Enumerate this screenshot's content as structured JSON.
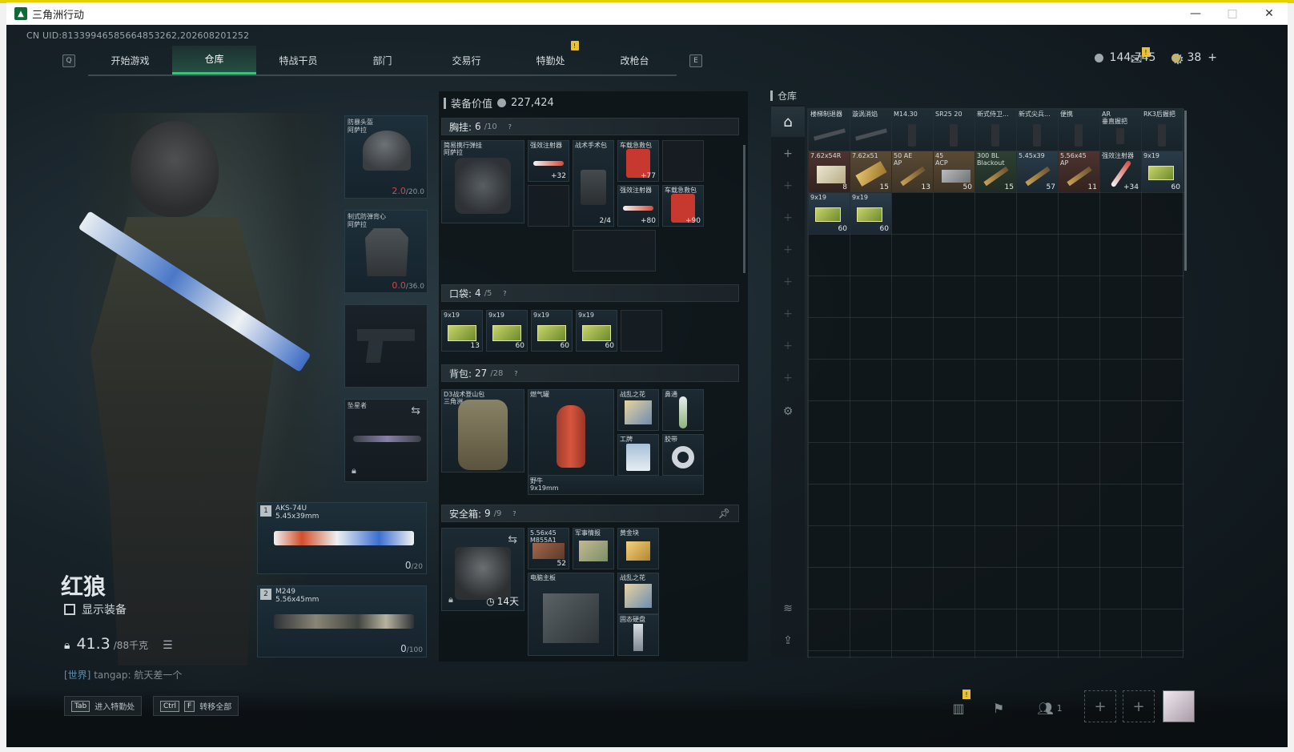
{
  "window": {
    "title": "三角洲行动",
    "minimize": "—",
    "maximize": "□",
    "close": "✕"
  },
  "header": {
    "uid": "CN UID:8133994658566485326​2,202608201252",
    "key_left": "Q",
    "key_right": "E",
    "tabs": [
      {
        "label": "开始游戏",
        "active": false
      },
      {
        "label": "仓库",
        "active": true
      },
      {
        "label": "特战干员",
        "active": false
      },
      {
        "label": "部门",
        "active": false
      },
      {
        "label": "交易行",
        "active": false
      },
      {
        "label": "特勤处",
        "active": false,
        "badge": "!"
      },
      {
        "label": "改枪台",
        "active": false
      }
    ],
    "silver": "144,745",
    "gold": "38",
    "gold_plus": "+",
    "mail_badge": "!"
  },
  "character": {
    "name": "红狼",
    "show_equip_label": "显示装备",
    "weight_value": "41.3",
    "weight_max": "/88千克",
    "chat_channel": "[世界]",
    "chat_text": "tangap: 航天差一个"
  },
  "equipment": {
    "helmet": {
      "label": "防暴头盔\n阿萨拉",
      "durability": "2.0",
      "max": "/20.0"
    },
    "armor": {
      "label": "制式防弹背心\n阿萨拉",
      "durability": "0.0",
      "max": "/36.0"
    },
    "melee": {
      "label": "坠星者"
    },
    "weapon1": {
      "num": "1",
      "name": "AKS-74U\n5.45x39mm",
      "ammo": "0",
      "ammo_max": "/20"
    },
    "weapon2": {
      "num": "2",
      "name": "M249\n5.56x45mm",
      "ammo": "0",
      "ammo_max": "/100"
    }
  },
  "loadout": {
    "value_label": "装备价值",
    "value": "227,424",
    "chest": {
      "title": "胸挂:",
      "count": "6",
      "cap": "/10",
      "q": "?",
      "rig_label": "简易携行弹挂\n阿萨拉",
      "items": [
        {
          "label": "强效注射器",
          "count": "+32"
        },
        {
          "label": "战术手术包",
          "count": "2/4"
        },
        {
          "label": "车载急救包",
          "count": "+77"
        },
        {
          "label": "强效注射器",
          "count": "+80"
        },
        {
          "label": "车载急救包",
          "count": "+90"
        }
      ]
    },
    "pocket": {
      "title": "口袋:",
      "count": "4",
      "cap": "/5",
      "q": "?",
      "items": [
        {
          "label": "9x19",
          "count": "13"
        },
        {
          "label": "9x19",
          "count": "60"
        },
        {
          "label": "9x19",
          "count": "60"
        },
        {
          "label": "9x19",
          "count": "60"
        }
      ]
    },
    "backpack": {
      "title": "背包:",
      "count": "27",
      "cap": "/28",
      "q": "?",
      "bag_label": "D3战术登山包\n三角洲",
      "items": [
        {
          "label": "燃气罐"
        },
        {
          "label": "战乱之花"
        },
        {
          "label": "鼻通"
        },
        {
          "label": "工牌"
        },
        {
          "label": "胶带"
        },
        {
          "label": "野牛\n9x19mm"
        }
      ]
    },
    "safe": {
      "title": "安全箱:",
      "count": "9",
      "cap": "/9",
      "q": "?",
      "timer": "14天",
      "items": [
        {
          "label": "5.56x45\nM855A1",
          "count": "52"
        },
        {
          "label": "军事情报"
        },
        {
          "label": "黄金块"
        },
        {
          "label": "电脑主板"
        },
        {
          "label": "战乱之花"
        },
        {
          "label": "固态硬盘"
        }
      ]
    }
  },
  "storage": {
    "title": "仓库",
    "row1": [
      {
        "label": "楼梯制退器"
      },
      {
        "label": "漩涡消焰"
      },
      {
        "label": "M14.30"
      },
      {
        "label": "SR25 20"
      },
      {
        "label": "新式侍卫..."
      },
      {
        "label": "新式尖兵..."
      },
      {
        "label": "便携"
      },
      {
        "label": "AR\n垂直握把"
      },
      {
        "label": "RK3后握把"
      }
    ],
    "row2": [
      {
        "label": "7.62x54R",
        "count": "8"
      },
      {
        "label": "7.62x51",
        "count": "15"
      },
      {
        "label": "50 AE\nAP",
        "count": "13"
      },
      {
        "label": "45\nACP",
        "count": "50"
      },
      {
        "label": "300 BL\nBlackout",
        "count": "15"
      },
      {
        "label": "5.45x39",
        "count": "57"
      },
      {
        "label": "5.56x45\nAP",
        "count": "11"
      },
      {
        "label": "强效注射器",
        "count": "+34"
      },
      {
        "label": "9x19",
        "count": "60"
      }
    ],
    "row3": [
      {
        "label": "9x19",
        "count": "60"
      },
      {
        "label": "9x19",
        "count": "60"
      }
    ]
  },
  "bottom": {
    "hint1_key": "Tab",
    "hint1_text": "进入特勤处",
    "hint2_key1": "Ctrl",
    "hint2_key2": "F",
    "hint2_text": "转移全部",
    "party_count": "1",
    "stats_badge": "!"
  },
  "colors": {
    "accent": "#3fbf7a",
    "durability_red": "#d9453f",
    "badge": "#e8c13a"
  },
  "icons": [
    "shield-icon",
    "gear-icon",
    "mail-icon",
    "lock-icon",
    "swap-icon",
    "clock-icon",
    "pin-icon",
    "plus-icon",
    "layers-icon",
    "transfer-icon",
    "chart-icon",
    "flag-icon",
    "party-icon",
    "list-icon"
  ]
}
